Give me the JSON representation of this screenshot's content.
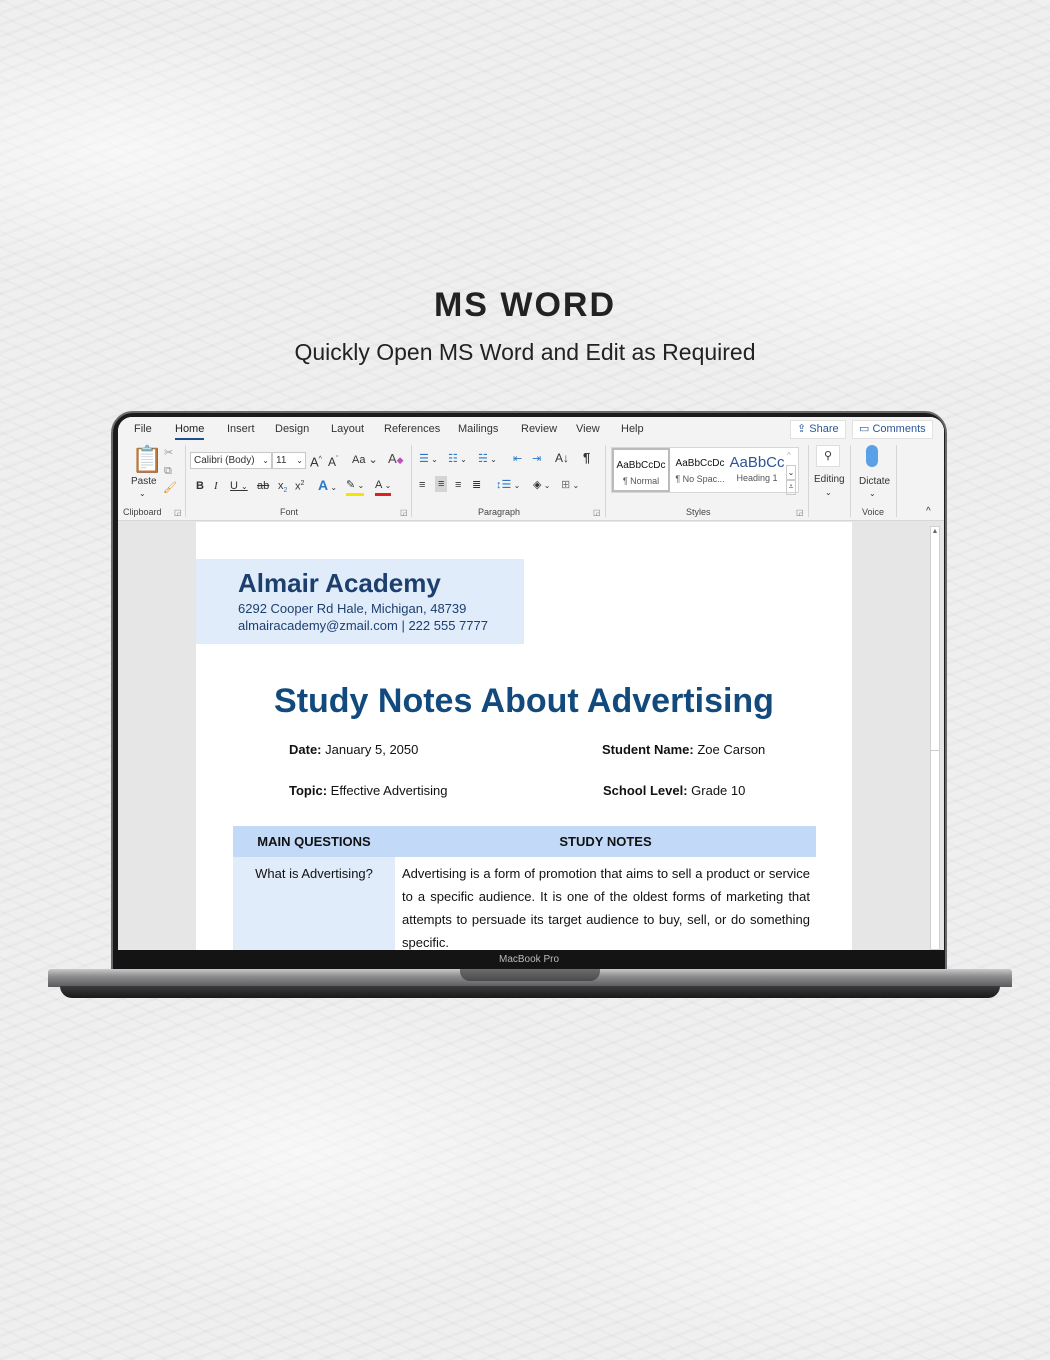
{
  "hero": {
    "title": "MS WORD",
    "subtitle": "Quickly Open MS Word and Edit as Required"
  },
  "device": {
    "label": "MacBook Pro"
  },
  "ribbon": {
    "tabs": [
      "File",
      "Home",
      "Insert",
      "Design",
      "Layout",
      "References",
      "Mailings",
      "Review",
      "View",
      "Help"
    ],
    "active_tab": "Home",
    "share_label": "Share",
    "comments_label": "Comments",
    "clipboard": {
      "label": "Clipboard",
      "paste_label": "Paste"
    },
    "font": {
      "label": "Font",
      "font_name": "Calibri (Body)",
      "font_size": "11",
      "change_case": "Aa"
    },
    "paragraph": {
      "label": "Paragraph"
    },
    "styles": {
      "label": "Styles",
      "items": [
        {
          "preview": "AaBbCcDc",
          "name": "¶ Normal"
        },
        {
          "preview": "AaBbCcDc",
          "name": "¶ No Spac..."
        },
        {
          "preview": "AaBbCc",
          "name": "Heading 1"
        }
      ]
    },
    "editing_label": "Editing",
    "voice": {
      "label": "Voice",
      "dictate_label": "Dictate"
    }
  },
  "document": {
    "academy": {
      "name": "Almair Academy",
      "address": "6292 Cooper Rd Hale, Michigan, 48739",
      "contact": "almairacademy@zmail.com | 222 555 7777"
    },
    "title": "Study Notes About Advertising",
    "meta": {
      "date_label": "Date:",
      "date_value": "January 5, 2050",
      "student_label": "Student Name:",
      "student_value": "Zoe Carson",
      "topic_label": "Topic:",
      "topic_value": "Effective Advertising",
      "level_label": "School Level:",
      "level_value": "Grade 10"
    },
    "table": {
      "headers": [
        "MAIN QUESTIONS",
        "STUDY NOTES"
      ],
      "rows": [
        {
          "question": "What is Advertising?",
          "notes": "Advertising is a form of promotion that aims to sell a product or service to a specific audience. It is one of the oldest forms of marketing that attempts to persuade its target audience to buy, sell, or do something specific."
        }
      ]
    }
  },
  "colors": {
    "accent": "#124a7d",
    "header_fill": "#e1ecfb",
    "table_head": "#c2daf8"
  }
}
